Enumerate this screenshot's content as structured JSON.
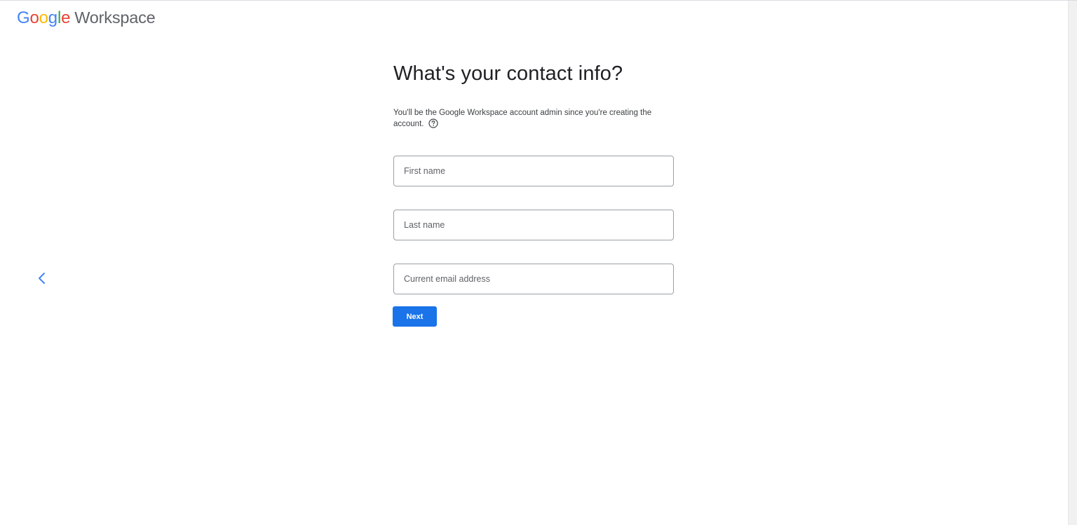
{
  "header": {
    "logo_google_letters": [
      "G",
      "o",
      "o",
      "g",
      "l",
      "e"
    ],
    "logo_google_colors": [
      "#4285F4",
      "#EA4335",
      "#FBBC05",
      "#4285F4",
      "#34A853",
      "#EA4335"
    ],
    "logo_product": "Workspace"
  },
  "nav": {
    "back_icon": "chevron-left-icon",
    "back_color": "#4285F4"
  },
  "form": {
    "title": "What's your contact info?",
    "subtitle": "You'll be the Google Workspace account admin since you're creating the account.",
    "help_icon": "help-circle-icon",
    "first_name": {
      "placeholder": "First name",
      "value": ""
    },
    "last_name": {
      "placeholder": "Last name",
      "value": ""
    },
    "email": {
      "placeholder": "Current email address",
      "value": ""
    },
    "next_label": "Next",
    "accent_color": "#1a73e8"
  }
}
